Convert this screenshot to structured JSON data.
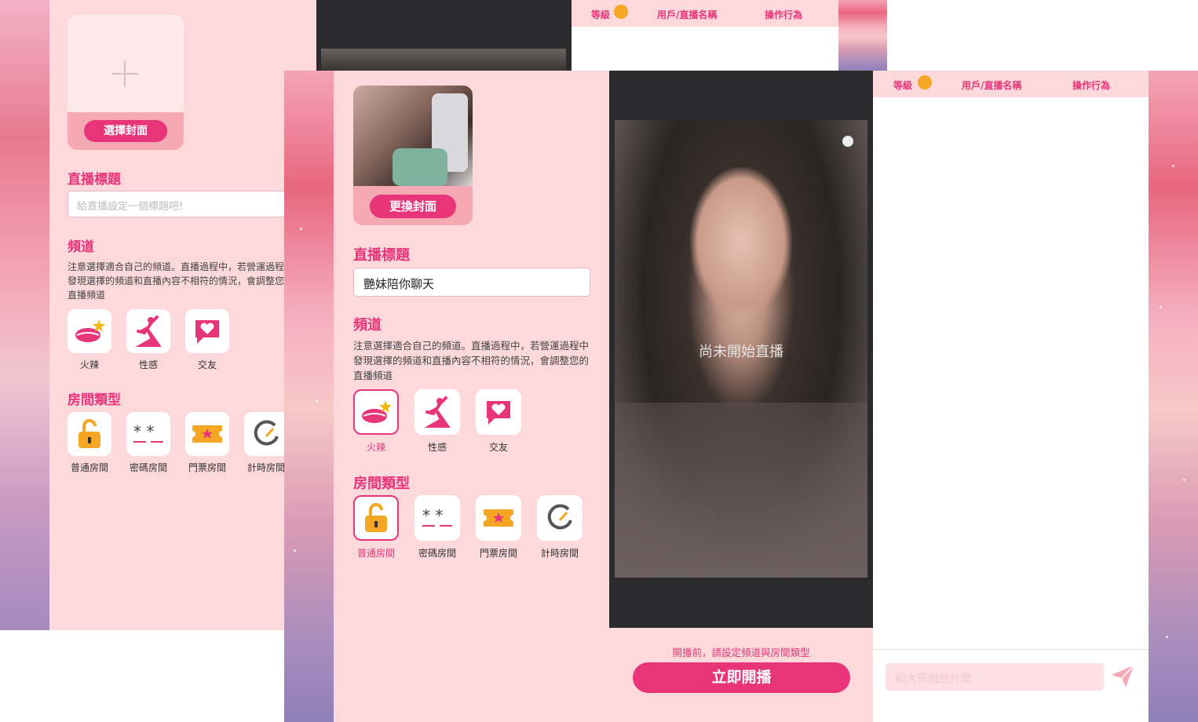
{
  "back": {
    "cover_button": "選擇封面",
    "title_heading": "直播標題",
    "title_placeholder": "給直播設定一個標題吧!",
    "channel_heading": "頻道",
    "channel_note": "注意選擇適合自己的頻道。直播過程中，若營運過程中發現選擇的頻道和直播內容不相符的情況，會調整您的直播頻道",
    "channels": [
      "火辣",
      "性感",
      "交友"
    ],
    "room_heading": "房間類型",
    "rooms": [
      "普通房間",
      "密碼房間",
      "門票房間",
      "計時房間"
    ],
    "header": {
      "level": "等級",
      "user": "用戶/直播名稱",
      "action": "操作行為"
    }
  },
  "front": {
    "cover_button": "更換封面",
    "title_heading": "直播標題",
    "title_value": "艷妹陪你聊天",
    "channel_heading": "頻道",
    "channel_note": "注意選擇適合自己的頻道。直播過程中，若營運過程中發現選擇的頻道和直播內容不相符的情況，會調整您的直播頻道",
    "channels": [
      "火辣",
      "性感",
      "交友"
    ],
    "selected_channel": "火辣",
    "room_heading": "房間類型",
    "rooms": [
      "普通房間",
      "密碼房間",
      "門票房間",
      "計時房間"
    ],
    "selected_room": "普通房間",
    "preview_status": "尚未開始直播",
    "start_hint": "開播前，請設定頻道與房間類型",
    "start_button": "立即開播",
    "header": {
      "level": "等級",
      "user": "用戶/直播名稱",
      "action": "操作行為"
    },
    "chat_placeholder": "和大家說些什麼"
  },
  "colors": {
    "accent": "#e8357a",
    "panel": "#fdd9dc",
    "dark": "#2b2b2e"
  }
}
